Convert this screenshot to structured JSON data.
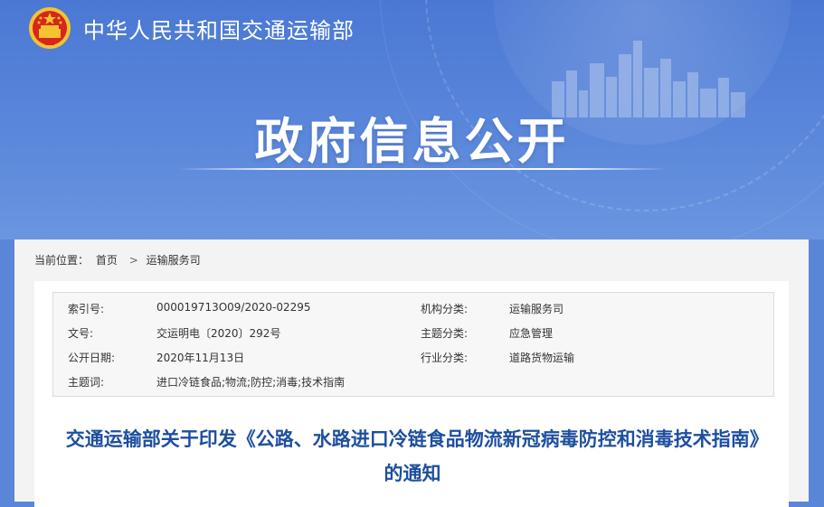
{
  "header": {
    "site_title": "中华人民共和国交通运输部",
    "section_title": "政府信息公开"
  },
  "breadcrumb": {
    "label": "当前位置：",
    "items": [
      "首页",
      "运输服务司"
    ],
    "separator": ">"
  },
  "info": {
    "index_label": "索引号:",
    "index_value": "000019713O09/2020-02295",
    "org_label": "机构分类:",
    "org_value": "运输服务司",
    "docno_label": "文号:",
    "docno_value": "交运明电〔2020〕292号",
    "topic_label": "主题分类:",
    "topic_value": "应急管理",
    "date_label": "公开日期:",
    "date_value": "2020年11月13日",
    "industry_label": "行业分类:",
    "industry_value": "道路货物运输",
    "keywords_label": "主题词:",
    "keywords_value": "进口冷链食品;物流;防控;消毒;技术指南"
  },
  "document": {
    "title": "交通运输部关于印发《公路、水路进口冷链食品物流新冠病毒防控和消毒技术指南》的通知"
  },
  "colors": {
    "banner": "#4a78d3",
    "title_blue": "#1d4f9e",
    "emblem_red": "#d8261c",
    "emblem_gold": "#f4c430"
  },
  "icons": [
    "national-emblem-icon",
    "city-skyline-graphic"
  ]
}
